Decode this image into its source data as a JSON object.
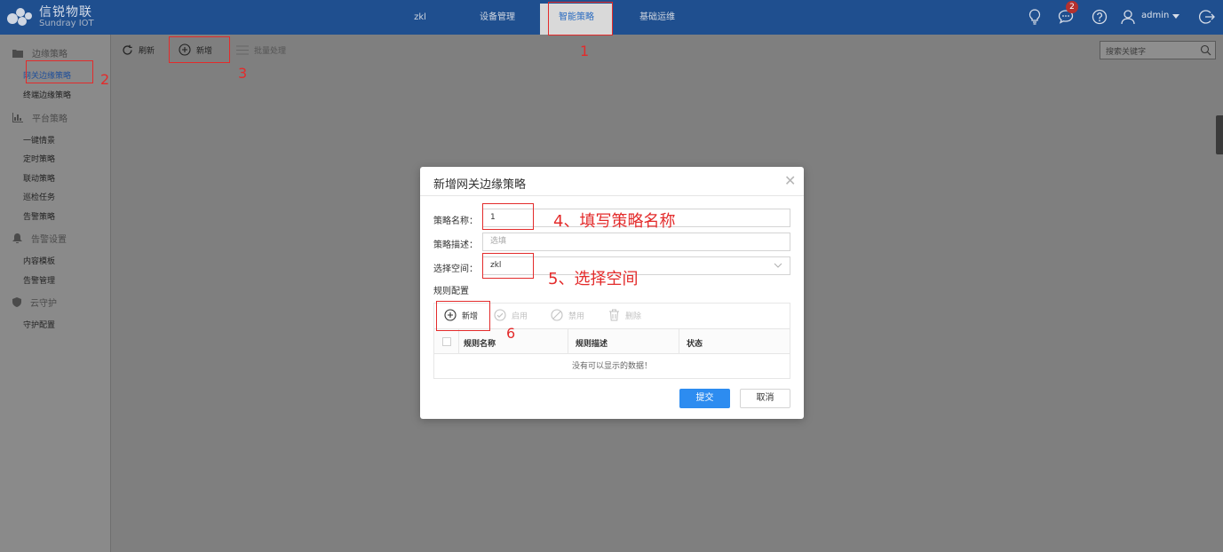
{
  "app": {
    "logo_cn": "信锐物联",
    "logo_en": "Sundray IOT"
  },
  "nav": {
    "items": [
      {
        "label": "zkl"
      },
      {
        "label": "设备管理"
      },
      {
        "label": "智能策略",
        "active": true
      },
      {
        "label": "基础运维"
      }
    ]
  },
  "header": {
    "notification_count": "2",
    "user_name": "admin"
  },
  "sidebar": {
    "groups": [
      {
        "label": "边缘策略",
        "icon": "folder-icon",
        "items": [
          "网关边缘策略",
          "终端边缘策略"
        ]
      },
      {
        "label": "平台策略",
        "icon": "chart-icon",
        "items": [
          "一键情景",
          "定时策略",
          "联动策略",
          "巡检任务",
          "告警策略"
        ]
      },
      {
        "label": "告警设置",
        "icon": "bell-icon",
        "items": [
          "内容模板",
          "告警管理"
        ]
      },
      {
        "label": "云守护",
        "icon": "shield-icon",
        "items": [
          "守护配置"
        ]
      }
    ],
    "active_item": "网关边缘策略"
  },
  "toolbar": {
    "refresh_label": "刷新",
    "add_label": "新增",
    "batch_label": "批量处理"
  },
  "search": {
    "placeholder": "搜索关键字"
  },
  "modal": {
    "title": "新增网关边缘策略",
    "fields": {
      "name_label": "策略名称：",
      "name_value": "1",
      "desc_label": "策略描述：",
      "desc_placeholder": "选填",
      "space_label": "选择空间：",
      "space_value": "zkl"
    },
    "rules": {
      "section_label": "规则配置",
      "add_label": "新增",
      "enable_label": "启用",
      "disable_label": "禁用",
      "delete_label": "删除",
      "columns": [
        "规则名称",
        "规则描述",
        "状态"
      ],
      "empty_message": "没有可以显示的数据！"
    },
    "submit_label": "提交",
    "cancel_label": "取消"
  },
  "annotations": {
    "step1": "1",
    "step2": "2",
    "step3": "3",
    "step4": "4、填写策略名称",
    "step5": "5、选择空间",
    "step6": "6"
  },
  "colors": {
    "header_bg": "#1f4f8f",
    "primary": "#2d8cf0",
    "annotation_red": "#e32b2b",
    "overlay_gray": "#7f7f7f"
  }
}
